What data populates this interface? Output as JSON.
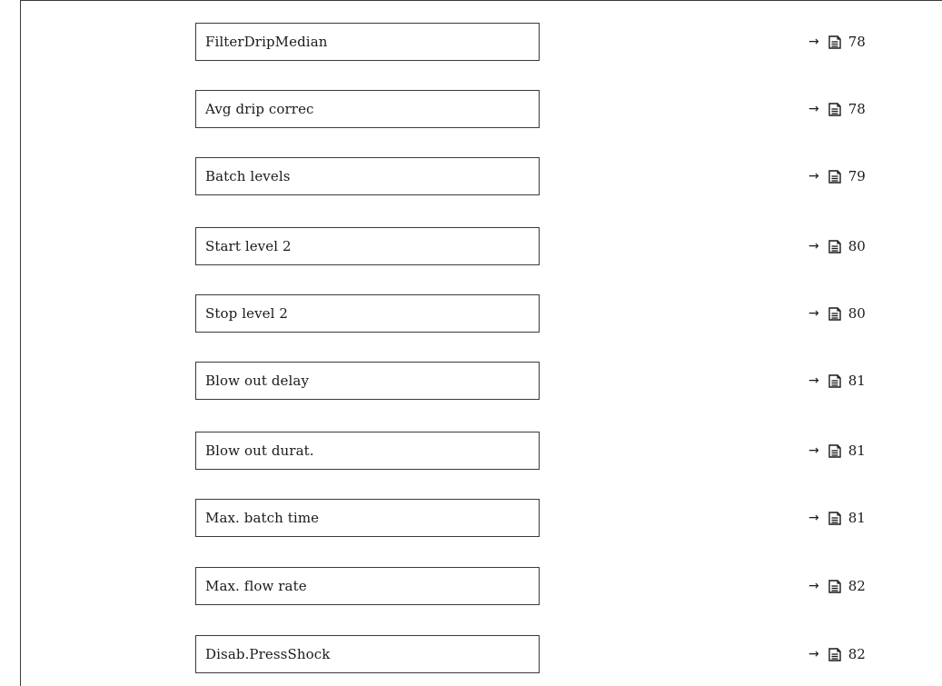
{
  "parameters": [
    {
      "label": "FilterDripMedian",
      "page": "78"
    },
    {
      "label": "Avg drip correc",
      "page": "78"
    },
    {
      "label": "Batch levels",
      "page": "79"
    },
    {
      "label": "Start level 2",
      "page": "80"
    },
    {
      "label": "Stop level 2",
      "page": "80"
    },
    {
      "label": "Blow out delay",
      "page": "81"
    },
    {
      "label": "Blow out durat.",
      "page": "81"
    },
    {
      "label": "Max. batch time",
      "page": "81"
    },
    {
      "label": "Max. flow rate",
      "page": "82"
    },
    {
      "label": "Disab.PressShock",
      "page": "82"
    }
  ],
  "reference": {
    "arrow": "→",
    "icon": "book-page-icon"
  }
}
